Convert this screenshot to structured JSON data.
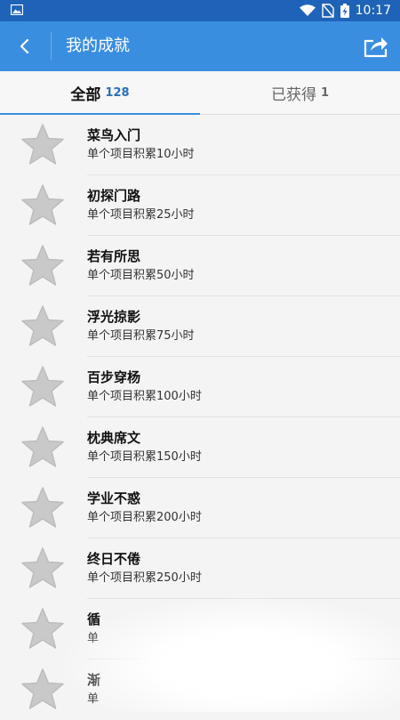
{
  "status_bar": {
    "time": "10:17"
  },
  "header": {
    "title": "我的成就"
  },
  "tabs": [
    {
      "label": "全部",
      "count": "128",
      "active": true
    },
    {
      "label": "已获得",
      "count": "1",
      "active": false
    }
  ],
  "achievements": [
    {
      "name": "菜鸟入门",
      "desc": "单个项目积累10小时"
    },
    {
      "name": "初探门路",
      "desc": "单个项目积累25小时"
    },
    {
      "name": "若有所思",
      "desc": "单个项目积累50小时"
    },
    {
      "name": "浮光掠影",
      "desc": "单个项目积累75小时"
    },
    {
      "name": "百步穿杨",
      "desc": "单个项目积累100小时"
    },
    {
      "name": "枕典席文",
      "desc": "单个项目积累150小时"
    },
    {
      "name": "学业不惑",
      "desc": "单个项目积累200小时"
    },
    {
      "name": "终日不倦",
      "desc": "单个项目积累250小时"
    },
    {
      "name": "循",
      "desc": "单"
    },
    {
      "name": "渐",
      "desc": "单"
    }
  ],
  "colors": {
    "status_bar": "#1e63b8",
    "app_bar": "#3a8ee0",
    "tab_accent": "#2a6fb8",
    "star": "#c9c9c9"
  },
  "icons": {
    "back": "chevron-left-icon",
    "share": "share-icon",
    "achievement": "star-icon"
  }
}
